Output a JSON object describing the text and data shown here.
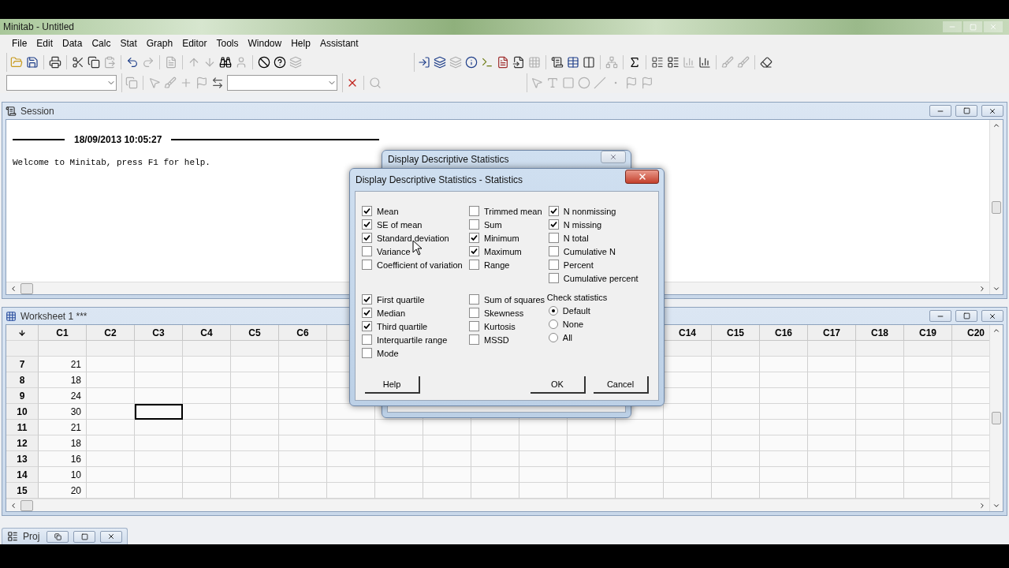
{
  "window": {
    "title": "Minitab - Untitled"
  },
  "menu": [
    "File",
    "Edit",
    "Data",
    "Calc",
    "Stat",
    "Graph",
    "Editor",
    "Tools",
    "Window",
    "Help",
    "Assistant"
  ],
  "session": {
    "title": "Session",
    "timestamp": "18/09/2013 10:05:27",
    "lines": [
      "Welcome to Minitab, press F1 for help."
    ]
  },
  "worksheet": {
    "title": "Worksheet 1 ***",
    "columns_left": [
      "C1",
      "C2",
      "C3",
      "C4",
      "C5",
      "C6"
    ],
    "columns_right": [
      "C14",
      "C15",
      "C16",
      "C17",
      "C18",
      "C19",
      "C20"
    ],
    "rows": [
      {
        "number": "7",
        "cells": [
          {
            "value": "21",
            "selected": false
          },
          {
            "selected": false
          },
          {
            "selected": false
          },
          {
            "selected": false
          },
          {
            "selected": false
          },
          {
            "selected": false
          }
        ]
      },
      {
        "number": "8",
        "cells": [
          {
            "value": "18",
            "selected": false
          },
          {
            "selected": false
          },
          {
            "selected": false
          },
          {
            "selected": false
          },
          {
            "selected": false
          },
          {
            "selected": false
          }
        ]
      },
      {
        "number": "9",
        "cells": [
          {
            "value": "24",
            "selected": false
          },
          {
            "selected": false
          },
          {
            "selected": false
          },
          {
            "selected": false
          },
          {
            "selected": false
          },
          {
            "selected": false
          }
        ]
      },
      {
        "number": "10",
        "cells": [
          {
            "value": "30",
            "selected": false
          },
          {
            "selected": false
          },
          {
            "selected": true
          },
          {
            "selected": false
          },
          {
            "selected": false
          },
          {
            "selected": false
          }
        ]
      },
      {
        "number": "11",
        "cells": [
          {
            "value": "21",
            "selected": false
          },
          {
            "selected": false
          },
          {
            "selected": false
          },
          {
            "selected": false
          },
          {
            "selected": false
          },
          {
            "selected": false
          }
        ]
      },
      {
        "number": "12",
        "cells": [
          {
            "value": "18",
            "selected": false
          },
          {
            "selected": false
          },
          {
            "selected": false
          },
          {
            "selected": false
          },
          {
            "selected": false
          },
          {
            "selected": false
          }
        ]
      },
      {
        "number": "13",
        "cells": [
          {
            "value": "16",
            "selected": false
          },
          {
            "selected": false
          },
          {
            "selected": false
          },
          {
            "selected": false
          },
          {
            "selected": false
          },
          {
            "selected": false
          }
        ]
      },
      {
        "number": "14",
        "cells": [
          {
            "value": "10",
            "selected": false
          },
          {
            "selected": false
          },
          {
            "selected": false
          },
          {
            "selected": false
          },
          {
            "selected": false
          },
          {
            "selected": false
          }
        ]
      },
      {
        "number": "15",
        "cells": [
          {
            "value": "20",
            "selected": false
          },
          {
            "selected": false
          },
          {
            "selected": false
          },
          {
            "selected": false
          },
          {
            "selected": false
          },
          {
            "selected": false
          }
        ]
      }
    ]
  },
  "dialog_behind": {
    "title": "Display Descriptive Statistics"
  },
  "dialog": {
    "title": "Display Descriptive Statistics - Statistics",
    "columns": [
      {
        "top": [
          {
            "label": "Mean",
            "checked": true
          },
          {
            "label": "SE of mean",
            "checked": true
          },
          {
            "label": "Standard deviation",
            "checked": true
          },
          {
            "label": "Variance",
            "checked": false
          },
          {
            "label": "Coefficient of variation",
            "checked": false
          }
        ],
        "bottom": [
          {
            "label": "First quartile",
            "checked": true
          },
          {
            "label": "Median",
            "checked": true
          },
          {
            "label": "Third quartile",
            "checked": true
          },
          {
            "label": "Interquartile range",
            "checked": false
          },
          {
            "label": "Mode",
            "checked": false
          }
        ]
      },
      {
        "top": [
          {
            "label": "Trimmed mean",
            "checked": false
          },
          {
            "label": "Sum",
            "checked": false
          },
          {
            "label": "Minimum",
            "checked": true
          },
          {
            "label": "Maximum",
            "checked": true
          },
          {
            "label": "Range",
            "checked": false
          }
        ],
        "bottom": [
          {
            "label": "Sum of squares",
            "checked": false
          },
          {
            "label": "Skewness",
            "checked": false
          },
          {
            "label": "Kurtosis",
            "checked": false
          },
          {
            "label": "MSSD",
            "checked": false
          }
        ]
      },
      {
        "top": [
          {
            "label": "N nonmissing",
            "checked": true
          },
          {
            "label": "N missing",
            "checked": true
          },
          {
            "label": "N total",
            "checked": false
          },
          {
            "label": "Cumulative N",
            "checked": false
          },
          {
            "label": "Percent",
            "checked": false
          },
          {
            "label": "Cumulative percent",
            "checked": false
          }
        ]
      }
    ],
    "check_statistics": {
      "label": "Check statistics",
      "options": [
        {
          "label": "Default",
          "selected": true
        },
        {
          "label": "None",
          "selected": false
        },
        {
          "label": "All",
          "selected": false
        }
      ]
    },
    "buttons": [
      "Help",
      "OK",
      "Cancel"
    ]
  },
  "minimized": [
    {
      "title": "Proj"
    }
  ]
}
